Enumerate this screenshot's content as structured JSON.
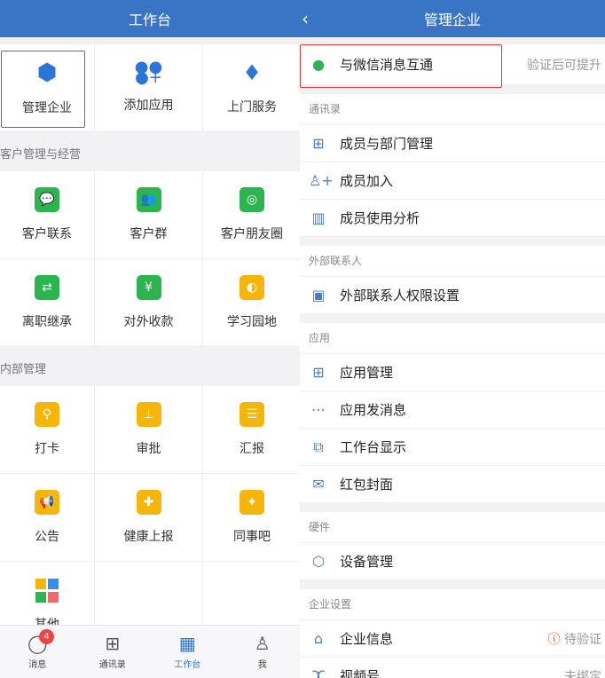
{
  "left": {
    "title": "工作台",
    "top_items": [
      {
        "label": "管理企业",
        "icon": "hexagon-icon"
      },
      {
        "label": "添加应用",
        "icon": "add-app-icon"
      },
      {
        "label": "上门服务",
        "icon": "tie-icon"
      }
    ],
    "sections": [
      {
        "title": "客户管理与经营",
        "items": [
          {
            "label": "客户联系",
            "icon": "chat-icon"
          },
          {
            "label": "客户群",
            "icon": "group-icon"
          },
          {
            "label": "客户朋友圈",
            "icon": "moments-icon"
          },
          {
            "label": "离职继承",
            "icon": "transfer-icon"
          },
          {
            "label": "对外收款",
            "icon": "yen-icon"
          },
          {
            "label": "学习园地",
            "icon": "planet-icon"
          }
        ]
      },
      {
        "title": "内部管理",
        "items": [
          {
            "label": "打卡",
            "icon": "location-icon"
          },
          {
            "label": "审批",
            "icon": "stamp-icon"
          },
          {
            "label": "汇报",
            "icon": "report-icon"
          },
          {
            "label": "公告",
            "icon": "megaphone-icon"
          },
          {
            "label": "健康上报",
            "icon": "health-icon"
          },
          {
            "label": "同事吧",
            "icon": "community-icon"
          },
          {
            "label": "其他",
            "icon": "apps-icon"
          }
        ]
      }
    ],
    "tabs": [
      {
        "label": "消息",
        "badge": "4"
      },
      {
        "label": "通讯录"
      },
      {
        "label": "工作台"
      },
      {
        "label": "我"
      }
    ]
  },
  "right": {
    "title": "管理企业",
    "wechat": {
      "label": "与微信消息互通",
      "value": "验证后可提升"
    },
    "groups": [
      {
        "title": "通讯录",
        "items": [
          {
            "label": "成员与部门管理"
          },
          {
            "label": "成员加入"
          },
          {
            "label": "成员使用分析"
          }
        ]
      },
      {
        "title": "外部联系人",
        "items": [
          {
            "label": "外部联系人权限设置"
          }
        ]
      },
      {
        "title": "应用",
        "items": [
          {
            "label": "应用管理"
          },
          {
            "label": "应用发消息"
          },
          {
            "label": "工作台显示"
          },
          {
            "label": "红包封面"
          }
        ]
      },
      {
        "title": "硬件",
        "items": [
          {
            "label": "设备管理"
          }
        ]
      },
      {
        "title": "企业设置",
        "items": [
          {
            "label": "企业信息",
            "value": "待验证"
          },
          {
            "label": "视频号",
            "value": "未绑定"
          }
        ]
      }
    ]
  }
}
